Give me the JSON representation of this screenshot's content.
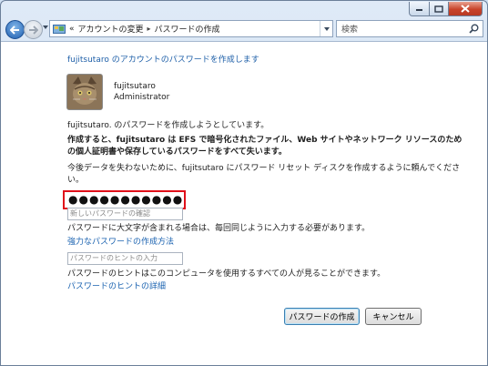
{
  "window": {
    "icons": [
      "minimize-icon",
      "maximize-icon",
      "close-icon"
    ]
  },
  "navbar": {
    "breadcrumb_lead": "«",
    "crumbs": [
      "アカウントの変更",
      "パスワードの作成"
    ],
    "crumb_separator": "▸",
    "search_placeholder": "検索"
  },
  "main": {
    "heading": "fujitsutaro のアカウントのパスワードを作成します",
    "user": {
      "name": "fujitsutaro",
      "role": "Administrator"
    },
    "intro": "fujitsutaro. のパスワードを作成しようとしています。",
    "warning": "作成すると、fujitsutaro は EFS で暗号化されたファイル、Web サイトやネットワーク リソースのための個人証明書や保存しているパスワードをすべて失います。",
    "advice": "今後データを失わないために、fujitsutaro にパスワード リセット ディスクを作成するように頼んでください。",
    "password_value": "●●●●●●●●●●●",
    "confirm_placeholder": "新しいパスワードの確認",
    "case_note": "パスワードに大文字が含まれる場合は、毎回同じように入力する必要があります。",
    "strong_password_link": "強力なパスワードの作成方法",
    "hint_placeholder": "パスワードのヒントの入力",
    "hint_note": "パスワードのヒントはこのコンピュータを使用するすべての人が見ることができます。",
    "hint_link": "パスワードのヒントの詳細"
  },
  "buttons": {
    "create": "パスワードの作成",
    "cancel": "キャンセル"
  },
  "colors": {
    "link": "#1a62b0",
    "highlight_border": "#e0101a"
  }
}
